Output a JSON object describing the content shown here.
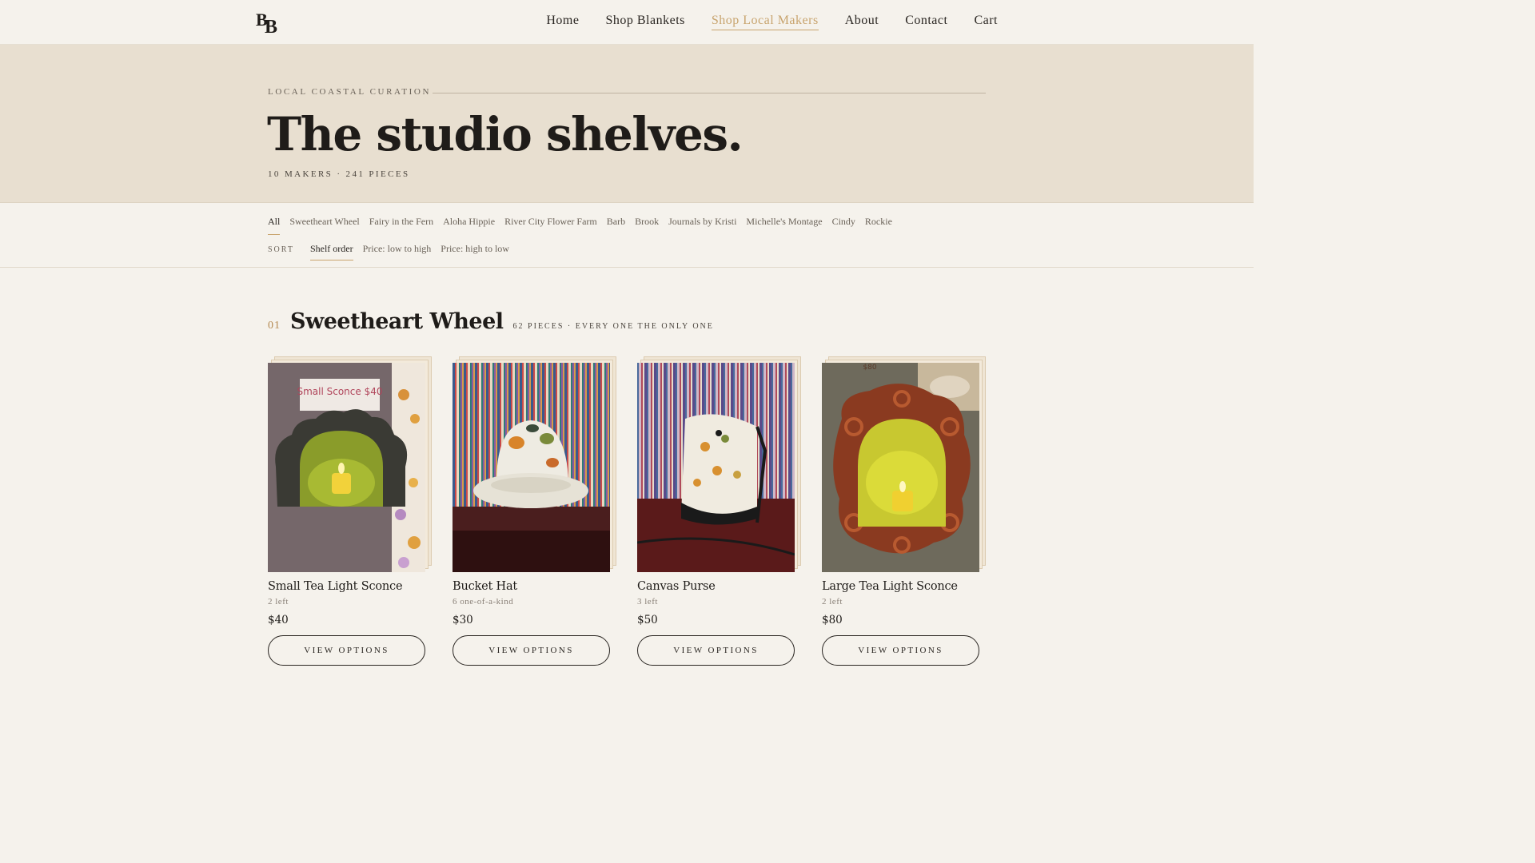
{
  "brand": {
    "logo_text_1": "B",
    "logo_text_2": "B"
  },
  "nav": [
    {
      "label": "Home",
      "active": false
    },
    {
      "label": "Shop Blankets",
      "active": false
    },
    {
      "label": "Shop Local Makers",
      "active": true
    },
    {
      "label": "About",
      "active": false
    },
    {
      "label": "Contact",
      "active": false
    },
    {
      "label": "Cart",
      "active": false
    }
  ],
  "hero": {
    "eyebrow": "LOCAL COASTAL CURATION",
    "title": "The studio shelves.",
    "stats": "10 MAKERS · 241 PIECES"
  },
  "filters": {
    "makers": [
      {
        "label": "All",
        "active": true
      },
      {
        "label": "Sweetheart Wheel",
        "active": false
      },
      {
        "label": "Fairy in the Fern",
        "active": false
      },
      {
        "label": "Aloha Hippie",
        "active": false
      },
      {
        "label": "River City Flower Farm",
        "active": false
      },
      {
        "label": "Barb",
        "active": false
      },
      {
        "label": "Brook",
        "active": false
      },
      {
        "label": "Journals by Kristi",
        "active": false
      },
      {
        "label": "Michelle's Montage",
        "active": false
      },
      {
        "label": "Cindy",
        "active": false
      },
      {
        "label": "Rockie",
        "active": false
      }
    ],
    "sort_label": "SORT",
    "sort_options": [
      {
        "label": "Shelf order",
        "active": true
      },
      {
        "label": "Price: low to high",
        "active": false
      },
      {
        "label": "Price: high to low",
        "active": false
      }
    ]
  },
  "section": {
    "number": "01",
    "title": "Sweetheart Wheel",
    "meta": "62 PIECES · EVERY ONE THE ONLY ONE"
  },
  "products": [
    {
      "name": "Small Tea Light Sconce",
      "stock": "2 left",
      "price": "$40",
      "button": "VIEW OPTIONS",
      "photo_sign": "Small Sconce $40"
    },
    {
      "name": "Bucket Hat",
      "stock": "6 one-of-a-kind",
      "price": "$30",
      "button": "VIEW OPTIONS"
    },
    {
      "name": "Canvas Purse",
      "stock": "3 left",
      "price": "$50",
      "button": "VIEW OPTIONS"
    },
    {
      "name": "Large Tea Light Sconce",
      "stock": "2 left",
      "price": "$80",
      "button": "VIEW OPTIONS",
      "photo_sign": "$80"
    }
  ],
  "colors": {
    "accent": "#c8a46e",
    "hero_bg": "#e8dfd0",
    "page_bg": "#f5f2ec",
    "ink": "#1f1c19"
  }
}
